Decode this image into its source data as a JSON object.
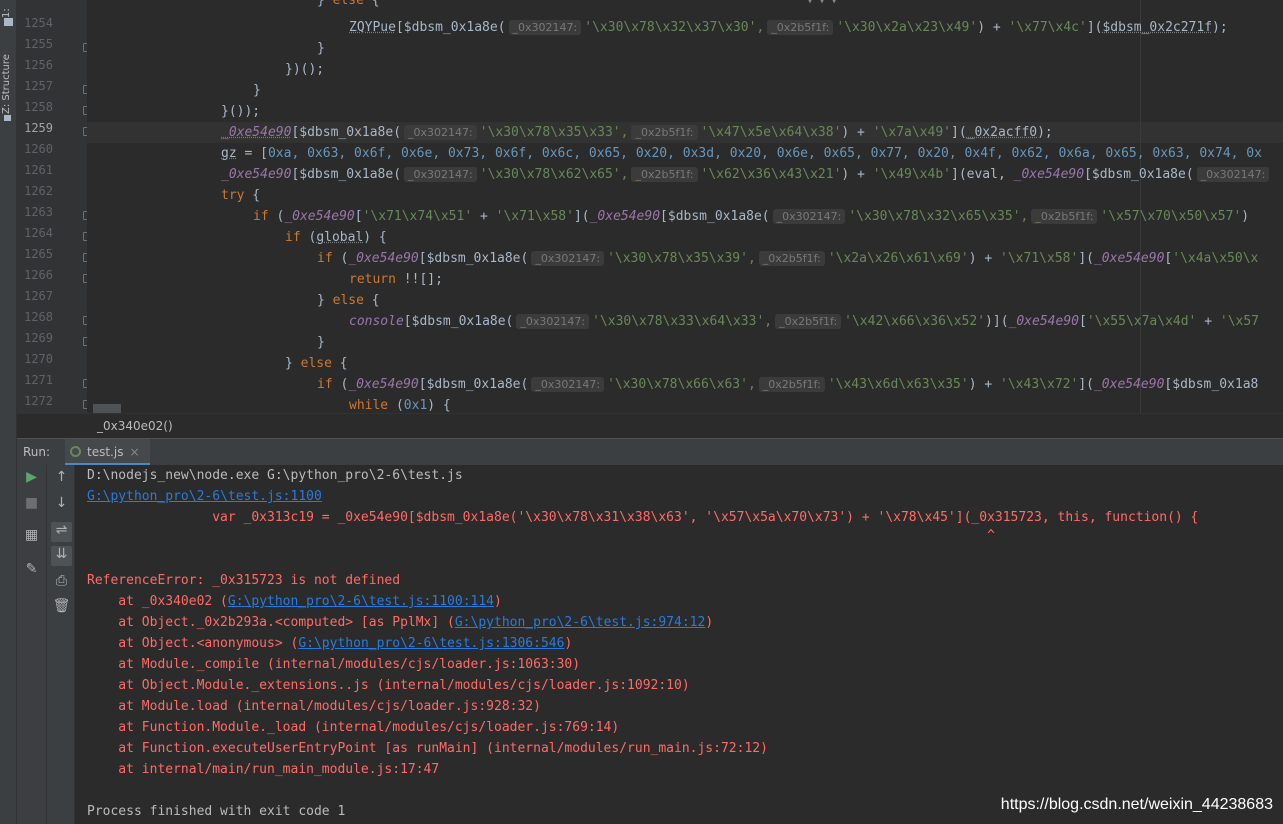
{
  "sidebar": {
    "tab1": "1:",
    "tab2": "Z: Structure"
  },
  "editor": {
    "top_partial": "} else {",
    "lines": [
      {
        "num": "1254",
        "current": false
      },
      {
        "num": "1255",
        "current": false
      },
      {
        "num": "1256",
        "current": false
      },
      {
        "num": "1257",
        "current": false
      },
      {
        "num": "1258",
        "current": false
      },
      {
        "num": "1259",
        "current": true
      },
      {
        "num": "1260",
        "current": false
      },
      {
        "num": "1261",
        "current": false
      },
      {
        "num": "1262",
        "current": false
      },
      {
        "num": "1263",
        "current": false
      },
      {
        "num": "1264",
        "current": false
      },
      {
        "num": "1265",
        "current": false
      },
      {
        "num": "1266",
        "current": false
      },
      {
        "num": "1267",
        "current": false
      },
      {
        "num": "1268",
        "current": false
      },
      {
        "num": "1269",
        "current": false
      },
      {
        "num": "1270",
        "current": false
      },
      {
        "num": "1271",
        "current": false
      },
      {
        "num": "1272",
        "current": false
      }
    ],
    "code": {
      "l1254_a": "ZQYPue",
      "l1254_b": "[$dbsm_0x1a8e(",
      "hint1": "_0x302147:",
      "s_1254_1": "'\\x30\\x78\\x32\\x37\\x30',",
      "hint2": "_0x2b5f1f:",
      "s_1254_2": "'\\x30\\x2a\\x23\\x49'",
      "l1254_plus": ") + ",
      "s_1254_3": "'\\x77\\x4c'",
      "l1254_tail": "](",
      "l1254_arg": "$dbsm_0x2c271f",
      "l1254_end": ");",
      "l1255": "}",
      "l1256": "})();",
      "l1257": "}",
      "l1258": "}());",
      "var_main": "_0xe54e90",
      "s_1259_1": "'\\x30\\x78\\x35\\x33',",
      "s_1259_2": "'\\x47\\x5e\\x64\\x38'",
      "s_1259_3": "'\\x7a\\x49'",
      "l1259_arg": "_0x2acff0",
      "gz": "gz",
      "gz_eq": " = [",
      "gz_vals": "0xa, 0x63, 0x6f, 0x6e, 0x73, 0x6f, 0x6c, 0x65, 0x20, 0x3d, 0x20, 0x6e, 0x65, 0x77, 0x20, 0x4f, 0x62, 0x6a, 0x65, 0x63, 0x74, 0x",
      "s_1261_1": "'\\x30\\x78\\x62\\x65',",
      "s_1261_2": "'\\x62\\x36\\x43\\x21'",
      "s_1261_3": "'\\x49\\x4b'",
      "l1261_eval": "](eval, ",
      "try": "try",
      "if": "if",
      "s_1263_0": "'\\x71\\x74\\x51'",
      "s_1263_1": "'\\x71\\x58'",
      "s_1263_2": "'\\x30\\x78\\x32\\x65\\x35',",
      "s_1263_3": "'\\x57\\x70\\x50\\x57'",
      "global": "global",
      "s_1265_1": "'\\x30\\x78\\x35\\x39',",
      "s_1265_2": "'\\x2a\\x26\\x61\\x69'",
      "s_1265_3": "'\\x71\\x58'",
      "s_1265_4": "'\\x4a\\x50\\x",
      "return": "return",
      "ret_val": " !![];",
      "else": "else",
      "console": "console",
      "s_1268_1": "'\\x30\\x78\\x33\\x64\\x33',",
      "s_1268_2": "'\\x42\\x66\\x36\\x52'",
      "s_1268_3": "'\\x55\\x7a\\x4d'",
      "s_1268_4": "'\\x57",
      "s_1271_1": "'\\x30\\x78\\x66\\x63',",
      "s_1271_2": "'\\x43\\x6d\\x63\\x35'",
      "s_1271_3": "'\\x43\\x72'",
      "l1271_tail": "[$dbsm_0x1a8",
      "while": "while",
      "while_val": "0x1"
    }
  },
  "breadcrumb": "_0x340e02()",
  "run_panel": {
    "label": "Run:",
    "tab": "test.js",
    "close": "×"
  },
  "console": {
    "cmd": "D:\\nodejs_new\\node.exe G:\\python_pro\\2-6\\test.js",
    "loc": "G:\\python_pro\\2-6\\test.js:1100",
    "code_line": "                var _0x313c19 = _0xe54e90[$dbsm_0x1a8e('\\x30\\x78\\x31\\x38\\x63', '\\x57\\x5a\\x70\\x73') + '\\x78\\x45'](_0x315723, this, function() {",
    "caret": "                                                                                                                   ^",
    "error": "ReferenceError: _0x315723 is not defined",
    "stack": [
      {
        "pre": "    at _0x340e02 (",
        "link": "G:\\python_pro\\2-6\\test.js:1100:114",
        "post": ")"
      },
      {
        "pre": "    at Object._0x2b293a.<computed> [as PplMx] (",
        "link": "G:\\python_pro\\2-6\\test.js:974:12",
        "post": ")"
      },
      {
        "pre": "    at Object.<anonymous> (",
        "link": "G:\\python_pro\\2-6\\test.js:1306:546",
        "post": ")"
      },
      {
        "pre": "    at Module._compile (internal/modules/cjs/loader.js:1063:30)",
        "link": "",
        "post": ""
      },
      {
        "pre": "    at Object.Module._extensions..js (internal/modules/cjs/loader.js:1092:10)",
        "link": "",
        "post": ""
      },
      {
        "pre": "    at Module.load (internal/modules/cjs/loader.js:928:32)",
        "link": "",
        "post": ""
      },
      {
        "pre": "    at Function.Module._load (internal/modules/cjs/loader.js:769:14)",
        "link": "",
        "post": ""
      },
      {
        "pre": "    at Function.executeUserEntryPoint [as runMain] (internal/modules/run_main.js:72:12)",
        "link": "",
        "post": ""
      },
      {
        "pre": "    at internal/main/run_main_module.js:17:47",
        "link": "",
        "post": ""
      }
    ],
    "exit": "Process finished with exit code 1"
  },
  "watermark": "https://blog.csdn.net/weixin_44238683",
  "toolbar_icons": [
    "play-icon",
    "stop-icon",
    "layout-icon",
    "pin-icon",
    "up-arrow-icon",
    "down-arrow-icon",
    "soft-wrap-icon",
    "scroll-to-end-icon",
    "print-icon",
    "trash-icon"
  ]
}
